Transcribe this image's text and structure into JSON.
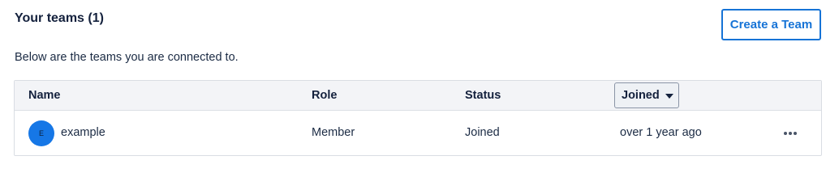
{
  "header": {
    "title": "Your teams (1)",
    "create_button_label": "Create a Team",
    "description": "Below are the teams you are connected to."
  },
  "table": {
    "columns": {
      "name": "Name",
      "role": "Role",
      "status": "Status",
      "joined": "Joined"
    },
    "sort": {
      "column": "Joined",
      "direction_icon": "caret-down-icon"
    },
    "rows": [
      {
        "avatar_initial": "E",
        "avatar_color": "#1677e6",
        "name": "example",
        "role": "Member",
        "status": "Joined",
        "joined": "over 1 year ago",
        "actions_icon": "more-horizontal-icon"
      }
    ]
  },
  "colors": {
    "accent": "#1673d6",
    "header_bg": "#f3f4f7",
    "text": "#1b2b44"
  }
}
